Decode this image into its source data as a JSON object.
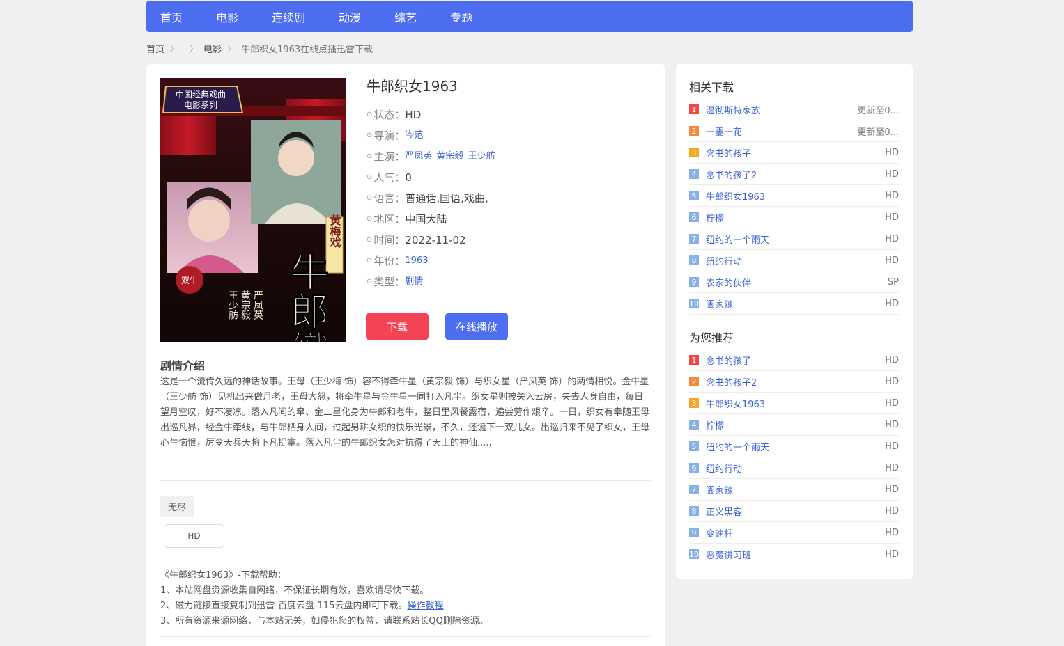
{
  "nav": [
    "首页",
    "电影",
    "连续剧",
    "动漫",
    "综艺",
    "专题"
  ],
  "breadcrumb": {
    "home": "首页",
    "category": "电影",
    "current": "牛郎织女1963在线点播迅雷下载"
  },
  "movie": {
    "title": "牛郎织女1963",
    "fields": [
      {
        "label": "状态：",
        "value": "HD"
      },
      {
        "label": "导演：",
        "links": [
          "岑范"
        ]
      },
      {
        "label": "主演：",
        "links": [
          "严凤英",
          "黄宗毅",
          "王少舫"
        ]
      },
      {
        "label": "人气：",
        "value": "0"
      },
      {
        "label": "语言：",
        "value": "普通话,国语,戏曲,"
      },
      {
        "label": "地区：",
        "value": "中国大陆"
      },
      {
        "label": "时间：",
        "value": "2022-11-02"
      },
      {
        "label": "年份：",
        "links": [
          "1963"
        ]
      },
      {
        "label": "类型：",
        "links": [
          "剧情"
        ]
      }
    ],
    "bullet": "⊙",
    "download_label": "下载",
    "play_label": "在线播放"
  },
  "poster": {
    "badge_line1": "中国经典戏曲",
    "badge_line2": "电影系列",
    "title_chars": "牛郎織女",
    "genre": "黄梅戏",
    "cast_cols": [
      "严凤英",
      "黄宗毅",
      "王少舫"
    ],
    "stamp": "双牛"
  },
  "synopsis": {
    "title": "剧情介绍",
    "text": "这是一个流传久远的神话故事。王母（王少梅 饰）容不得牵牛星（黄宗毅 饰）与织女星（严凤英 饰）的两情相悦。金牛星（王少舫 饰）见机出来做月老，王母大怒，将牵牛星与金牛星一同打入凡尘。织女星则被关入云房，失去人身自由，每日望月空叹，好不凄凉。落入凡间的牵、金二星化身为牛郎和老牛，整日里风餐露宿，遍尝劳作艰辛。一日，织女有幸随王母出巡凡界，经金牛牵线，与牛郎栖身人间，过起男耕女织的快乐光景，不久，还诞下一双儿女。出巡归来不见了织女，王母心生恼恨，厉令天兵天将下凡捉拿。落入凡尘的牛郎织女怎对抗得了天上的神仙....."
  },
  "source": {
    "tab": "无尽",
    "episode": "HD"
  },
  "help": {
    "line0": "《牛郎织女1963》-下载帮助：",
    "line1": "1、本站网盘资源收集自网络，不保证长期有效，喜欢请尽快下载。",
    "line2": "2、磁力链接直接复制到迅雷-百度云盘-115云盘内即可下载。",
    "line2_link": "操作教程",
    "line3": "3、所有资源来源网络，与本站无关，如侵犯您的权益，请联系站长QQ删除资源。"
  },
  "related": {
    "title": "相关下载",
    "items": [
      {
        "num": "1",
        "name": "温彻斯特家族",
        "tag": "更新至0..."
      },
      {
        "num": "2",
        "name": "一霎一花",
        "tag": "更新至0..."
      },
      {
        "num": "3",
        "name": "念书的孩子",
        "tag": "HD"
      },
      {
        "num": "4",
        "name": "念书的孩子2",
        "tag": "HD"
      },
      {
        "num": "5",
        "name": "牛郎织女1963",
        "tag": "HD"
      },
      {
        "num": "6",
        "name": "柠檬",
        "tag": "HD"
      },
      {
        "num": "7",
        "name": "纽约的一个雨天",
        "tag": "HD"
      },
      {
        "num": "8",
        "name": "纽约行动",
        "tag": "HD"
      },
      {
        "num": "9",
        "name": "农家的伙伴",
        "tag": "SP"
      },
      {
        "num": "10",
        "name": "阖家辣",
        "tag": "HD"
      }
    ]
  },
  "recommend": {
    "title": "为您推荐",
    "items": [
      {
        "num": "1",
        "name": "念书的孩子",
        "tag": "HD"
      },
      {
        "num": "2",
        "name": "念书的孩子2",
        "tag": "HD"
      },
      {
        "num": "3",
        "name": "牛郎织女1963",
        "tag": "HD"
      },
      {
        "num": "4",
        "name": "柠檬",
        "tag": "HD"
      },
      {
        "num": "5",
        "name": "纽约的一个雨天",
        "tag": "HD"
      },
      {
        "num": "6",
        "name": "纽约行动",
        "tag": "HD"
      },
      {
        "num": "7",
        "name": "阖家辣",
        "tag": "HD"
      },
      {
        "num": "8",
        "name": "正义黑客",
        "tag": "HD"
      },
      {
        "num": "9",
        "name": "变速杆",
        "tag": "HD"
      },
      {
        "num": "10",
        "name": "恶魔讲习班",
        "tag": "HD"
      }
    ]
  },
  "colors": {
    "accent": "#4e6ef2",
    "danger": "#f44354",
    "rank1": "#f04848",
    "rank2": "#f58a3c",
    "rank3": "#f5a623",
    "rank_other": "#8ab0e8"
  }
}
